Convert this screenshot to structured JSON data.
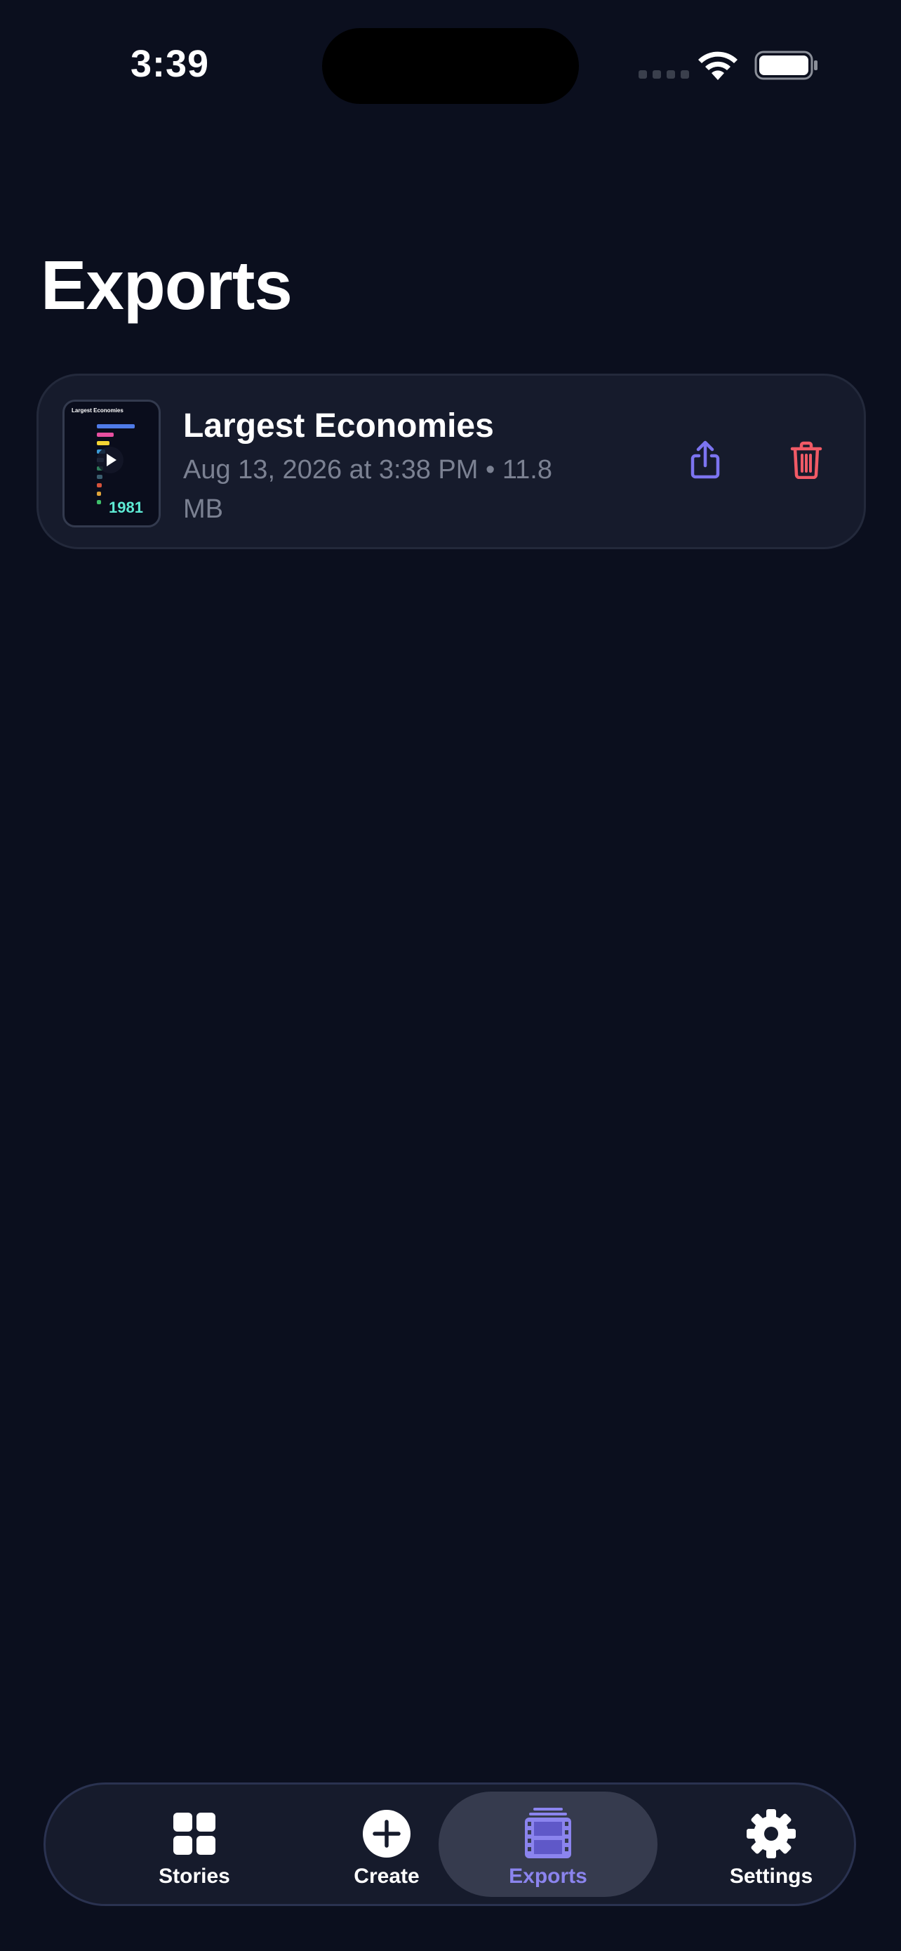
{
  "status": {
    "time": "3:39"
  },
  "page": {
    "title": "Exports"
  },
  "exports": [
    {
      "title": "Largest Economies",
      "meta": "Aug 13, 2026 at 3:38 PM • 11.8 MB",
      "thumbnail": {
        "title": "Largest Economies",
        "year": "1981"
      }
    }
  ],
  "tabs": [
    {
      "label": "Stories",
      "icon": "grid-icon",
      "active": false
    },
    {
      "label": "Create",
      "icon": "plus-circle-icon",
      "active": false
    },
    {
      "label": "Exports",
      "icon": "film-icon",
      "active": true
    },
    {
      "label": "Settings",
      "icon": "gear-icon",
      "active": false
    }
  ],
  "colors": {
    "accent": "#7c74f0",
    "danger": "#f05a66",
    "background": "#0b0f1e"
  }
}
